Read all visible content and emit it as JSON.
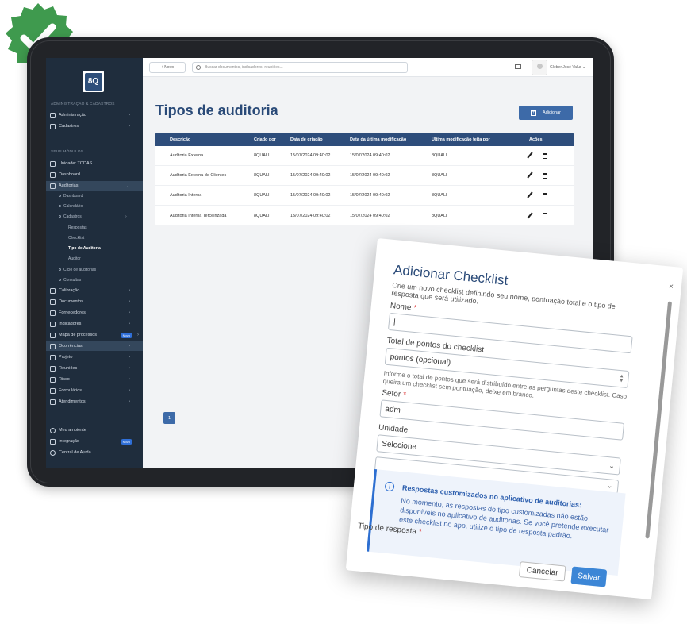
{
  "sidebar": {
    "logo": "8Q",
    "section_admin": "ADMINISTRAÇÃO & CADASTROS",
    "admin_items": [
      "Administração",
      "Cadastros"
    ],
    "section_modules": "SEUS MÓDULOS",
    "unidade": "Unidade: TODAS",
    "dashboard": "Dashboard",
    "auditorias": "Auditorias",
    "audit_sub": [
      "Dashboard",
      "Calendário",
      "Cadastros"
    ],
    "cadastros_sub": [
      "Respostas",
      "Checklist",
      "Tipo de Auditoria",
      "Auditor"
    ],
    "audit_sub2": [
      "Ciclo de auditorias",
      "Consultas"
    ],
    "modules": [
      "Calibração",
      "Documentos",
      "Fornecedores",
      "Indicadores",
      "Mapa de processos",
      "Ocorrências",
      "Projeto",
      "Reuniões",
      "Risco",
      "Formulários",
      "Atendimentos"
    ],
    "new_badge": "Novo",
    "bottom": [
      "Meu ambiente",
      "Integração",
      "Central de Ajuda"
    ]
  },
  "topbar": {
    "new_label": "+ Novo",
    "search_placeholder": "Buscar documentos, indicadores, reuniões...",
    "user": "Gleber José Valur"
  },
  "main": {
    "title": "Tipos de auditoria",
    "add_label": "Adicionar",
    "columns": [
      "Descrição",
      "Criado por",
      "Data de criação",
      "Data da última modificação",
      "Última modificação feita por",
      "Ações"
    ],
    "rows": [
      [
        "Auditoria Externa",
        "8QUALI",
        "15/07/2024 09:40:02",
        "15/07/2024 09:40:02",
        "8QUALI"
      ],
      [
        "Auditoria Externa de Clientes",
        "8QUALI",
        "15/07/2024 09:40:02",
        "15/07/2024 09:40:02",
        "8QUALI"
      ],
      [
        "Auditoria Interna",
        "8QUALI",
        "15/07/2024 09:40:02",
        "15/07/2024 09:40:02",
        "8QUALI"
      ],
      [
        "Auditoria Interna Terceirizada",
        "8QUALI",
        "15/07/2024 09:40:02",
        "15/07/2024 09:40:02",
        "8QUALI"
      ]
    ],
    "page": "1"
  },
  "modal": {
    "title": "Adicionar Checklist",
    "subtitle": "Crie um novo checklist definindo seu nome, pontuação total e o tipo de resposta que será utilizado.",
    "name_label": "Nome",
    "name_value": "|",
    "points_label": "Total de pontos do checklist",
    "points_placeholder": "pontos (opcional)",
    "points_help": "Informe o total de pontos que será distribuído entre as perguntas deste checklist. Caso queira um checklist sem pontuação, deixe em branco.",
    "sector_label": "Setor",
    "sector_value": "adm",
    "unit_label": "Unidade",
    "unit_value": "Selecione",
    "info_title": "Respostas customizados no aplicativo de auditorias:",
    "info_text": "No momento, as respostas do tipo customizadas não estão disponíveis no aplicativo de auditorias. Se você pretende executar este checklist no app, utilize o tipo de resposta padrão.",
    "response_label": "Tipo de resposta",
    "cancel": "Cancelar",
    "save": "Salvar",
    "close": "×"
  },
  "colors": {
    "sidebar_bg": "#1f2d3d",
    "primary": "#3d6aa8",
    "title": "#2a4a78",
    "save": "#3c86d6",
    "badge": "#3f9a4e"
  }
}
